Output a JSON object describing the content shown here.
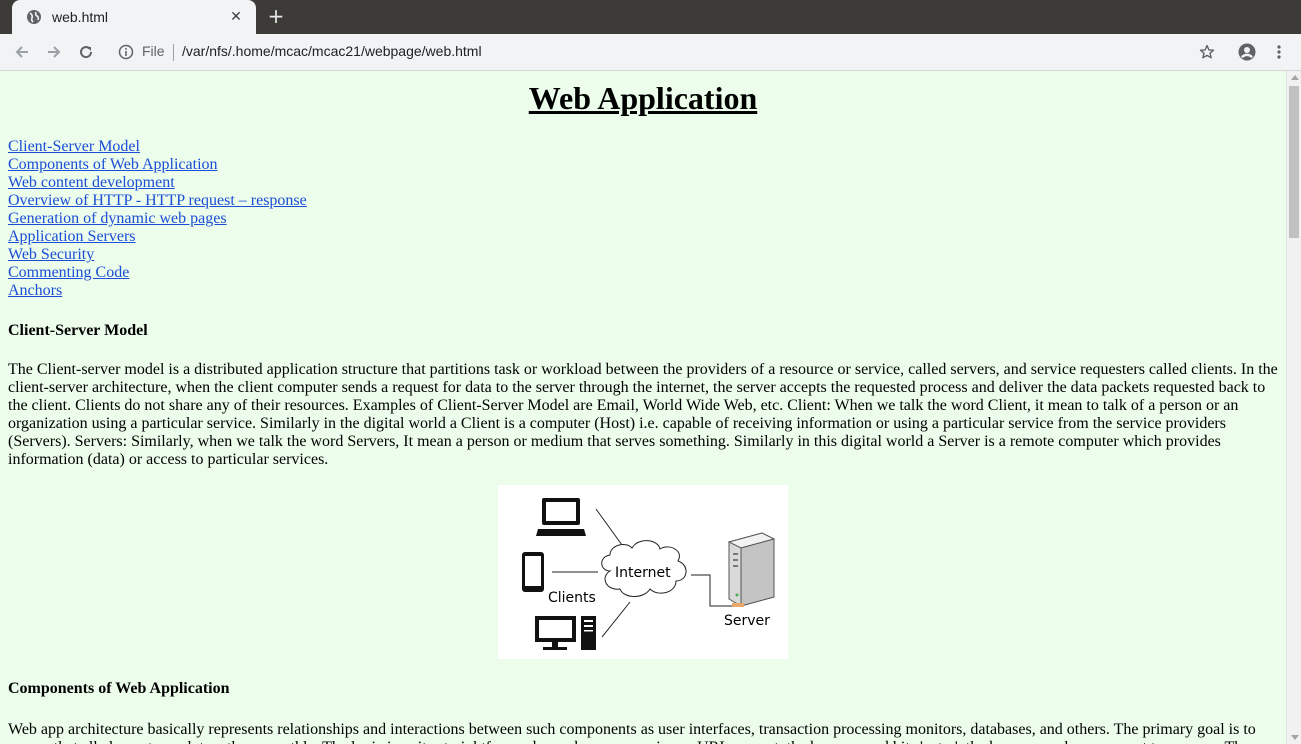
{
  "browser": {
    "tab_title": "web.html",
    "omnibox_scheme": "File",
    "url": "/var/nfs/.home/mcac/mcac21/webpage/web.html"
  },
  "page": {
    "title": "Web Application",
    "nav_links": [
      "Client-Server Model",
      "Components of Web Application",
      "Web content development",
      "Overview of HTTP - HTTP request – response",
      "Generation of dynamic web pages",
      "Application Servers",
      "Web Security",
      "Commenting Code",
      "Anchors"
    ],
    "section1": {
      "heading": "Client-Server Model",
      "text": "The Client-server model is a distributed application structure that partitions task or workload between the providers of a resource or service, called servers, and service requesters called clients. In the client-server architecture, when the client computer sends a request for data to the server through the internet, the server accepts the requested process and deliver the data packets requested back to the client. Clients do not share any of their resources. Examples of Client-Server Model are Email, World Wide Web, etc. Client: When we talk the word Client, it mean to talk of a person or an organization using a particular service. Similarly in the digital world a Client is a computer (Host) i.e. capable of receiving information or using a particular service from the service providers (Servers). Servers: Similarly, when we talk the word Servers, It mean a person or medium that serves something. Similarly in this digital world a Server is a remote computer which provides information (data) or access to particular services."
    },
    "diagram": {
      "internet_label": "Internet",
      "clients_label": "Clients",
      "server_label": "Server"
    },
    "section2": {
      "heading": "Components of Web Application",
      "text": "Web app architecture basically represents relationships and interactions between such components as user interfaces, transaction processing monitors, databases, and others. The primary goal is to ensure that all elements work together smoothly. The logic is quite straightforward: a web server receives a URL request, the browser and hits 'enter', the browser makes a request to a server. The"
    }
  }
}
